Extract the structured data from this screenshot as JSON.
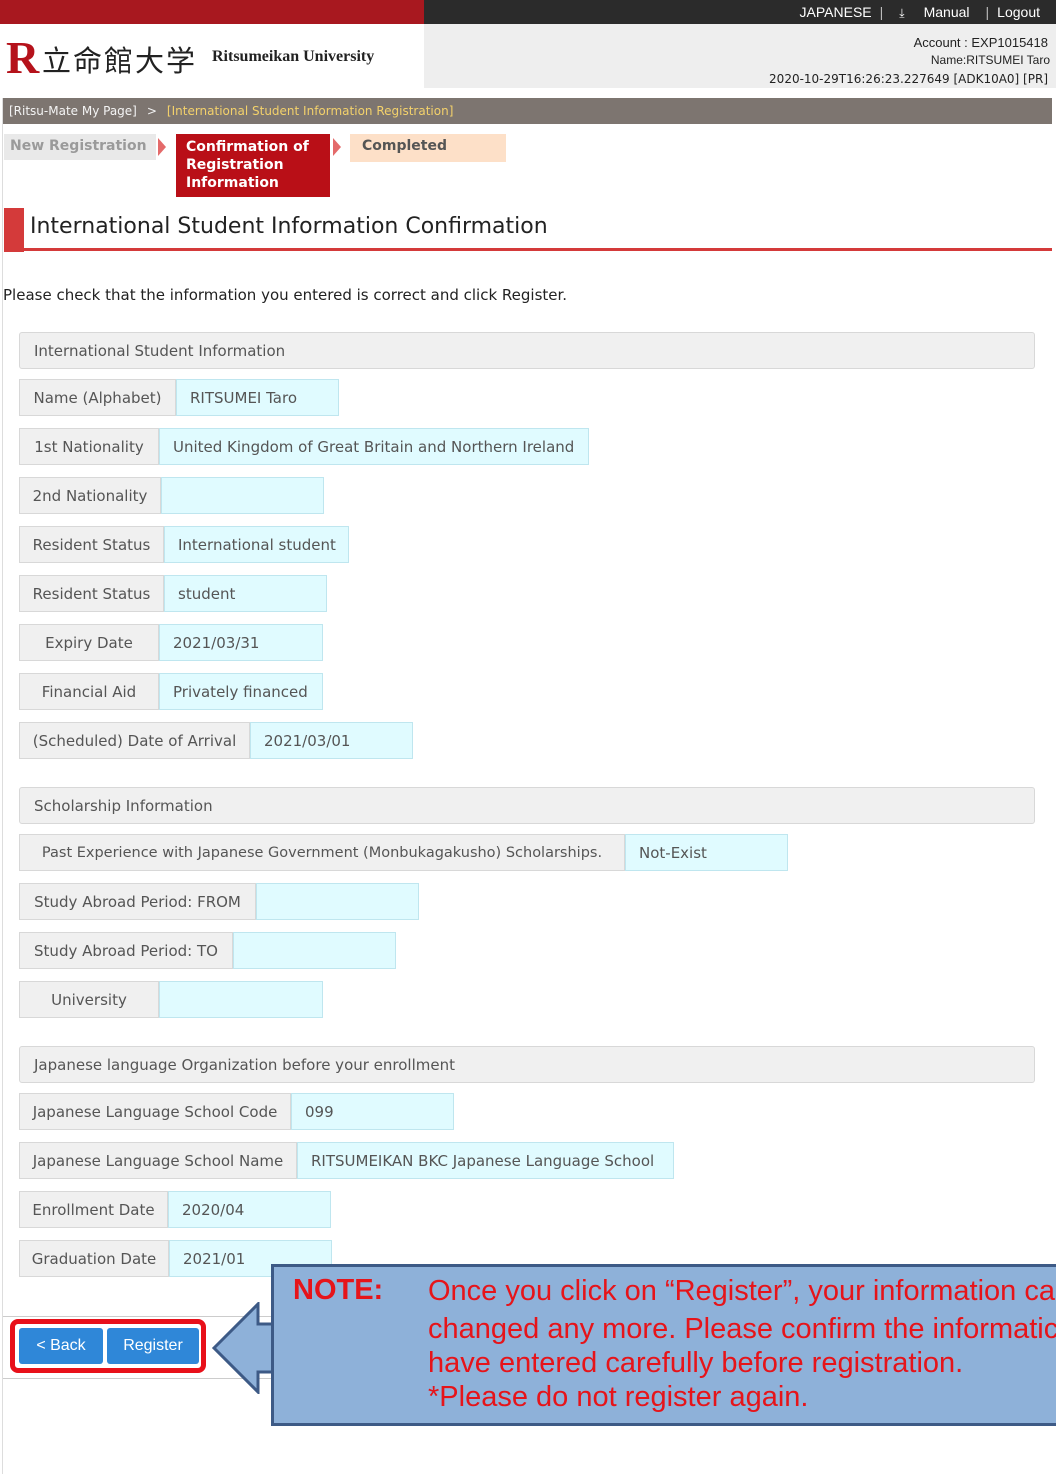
{
  "topbar": {
    "language": "JAPANESE",
    "manual": "Manual",
    "logout": "Logout"
  },
  "logo": {
    "r_mark": "R",
    "kanji": "立命館大学",
    "english": "Ritsumeikan University"
  },
  "account": {
    "account_line": "Account : EXP1015418",
    "name_line": "Name:RITSUMEI Taro",
    "timestamp_line": "2020-10-29T16:26:23.227649 [ADK10A0] [PR]"
  },
  "breadcrumb": {
    "home": "[Ritsu-Mate My Page]",
    "separator": ">",
    "current": "[International Student Information Registration]"
  },
  "steps": {
    "step1": "New Registration",
    "step2": "Confirmation of Registration Information",
    "step3": "Completed"
  },
  "page_title": "International Student Information Confirmation",
  "intro": "Please check that the information you entered is correct and click Register.",
  "sections": {
    "international": "International Student Information",
    "scholarship": "Scholarship Information",
    "japanese_org": "Japanese language Organization before your enrollment"
  },
  "fields": {
    "name_label": "Name (Alphabet)",
    "name_value": "RITSUMEI Taro",
    "nat1_label": "1st Nationality",
    "nat1_value": "United Kingdom of Great Britain and Northern Ireland",
    "nat2_label": "2nd Nationality",
    "nat2_value": "",
    "res1_label": "Resident Status",
    "res1_value": "International student",
    "res2_label": "Resident Status",
    "res2_value": "student",
    "expiry_label": "Expiry Date",
    "expiry_value": "2021/03/31",
    "aid_label": "Financial Aid",
    "aid_value": "Privately financed",
    "arrival_label": "(Scheduled) Date of Arrival",
    "arrival_value": "2021/03/01",
    "past_label": "Past Experience with Japanese Government (Monbukagakusho) Scholarships.",
    "past_value": "Not-Exist",
    "from_label": "Study Abroad Period: FROM",
    "from_value": "",
    "to_label": "Study Abroad Period: TO",
    "to_value": "",
    "univ_label": "University",
    "univ_value": "",
    "school_code_label": "Japanese Language School Code",
    "school_code_value": "099",
    "school_name_label": "Japanese Language School Name",
    "school_name_value": "RITSUMEIKAN BKC Japanese Language School",
    "enroll_label": "Enrollment Date",
    "enroll_value": "2020/04",
    "grad_label": "Graduation Date",
    "grad_value": "2021/01"
  },
  "buttons": {
    "back": "< Back",
    "register": "Register"
  },
  "note": {
    "title": "NOTE:",
    "line1": "Once you click on “Register”, your information ca",
    "line2": "changed any more. Please confirm the informatic",
    "line3": "have entered carefully before registration.",
    "line4": "*Please do not register again."
  },
  "colors": {
    "brand_red": "#b90f17",
    "accent_blue": "#2f87d8",
    "value_bg": "#e0fbff",
    "note_bg": "#8eb1d9",
    "note_text": "#e6141a"
  }
}
